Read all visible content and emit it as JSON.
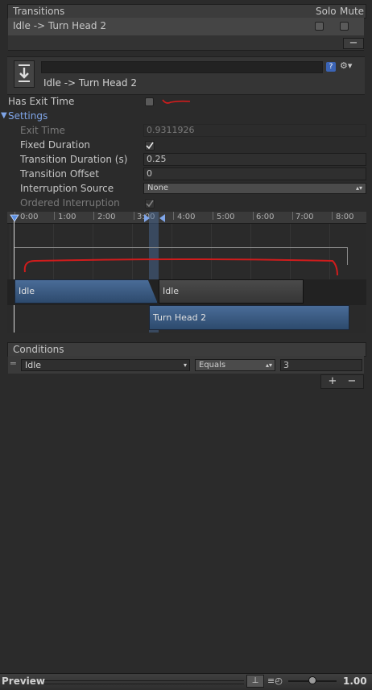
{
  "transitions": {
    "header_title": "Transitions",
    "solo_label": "Solo",
    "mute_label": "Mute",
    "items": [
      {
        "name": "Idle -> Turn Head 2"
      }
    ],
    "remove_label": "−"
  },
  "transition_header": {
    "name_value": "",
    "subtitle": "Idle -> Turn Head 2",
    "help_label": "?",
    "gear_label": "⚙▾"
  },
  "settings": {
    "has_exit_time_label": "Has Exit Time",
    "section_label": "Settings",
    "exit_time_label": "Exit Time",
    "exit_time_value": "0.9311926",
    "fixed_duration_label": "Fixed Duration",
    "transition_duration_label": "Transition Duration (s)",
    "transition_duration_value": "0.25",
    "transition_offset_label": "Transition Offset",
    "transition_offset_value": "0",
    "interruption_source_label": "Interruption Source",
    "interruption_source_value": "None",
    "ordered_interruption_label": "Ordered Interruption"
  },
  "timeline": {
    "ticks": [
      "0:00",
      "1:00",
      "2:00",
      "3:00",
      "4:00",
      "5:00",
      "6:00",
      "7:00",
      "8:00"
    ],
    "source_state": "Idle",
    "source_state_repeat": "Idle",
    "destination_state": "Turn Head 2"
  },
  "conditions": {
    "header_title": "Conditions",
    "parameter": "Idle",
    "mode": "Equals",
    "value": "3",
    "add_label": "+",
    "remove_label": "−"
  },
  "preview": {
    "title": "Preview",
    "speed_value": "1.00"
  },
  "colors": {
    "accent_blue": "#7fa5e8",
    "scribble_red": "#d01c1c"
  }
}
